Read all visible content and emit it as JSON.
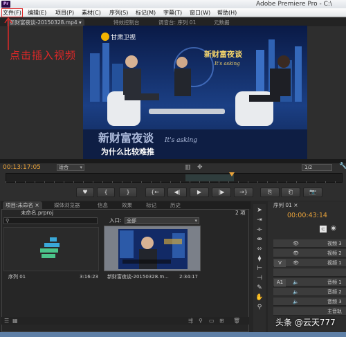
{
  "window": {
    "app_icon_text": "Pr",
    "title": "Adobe Premiere Pro - C:\\"
  },
  "menu": [
    {
      "label": "文件(F)"
    },
    {
      "label": "编辑(E)"
    },
    {
      "label": "项目(P)"
    },
    {
      "label": "素材(C)"
    },
    {
      "label": "序列(S)"
    },
    {
      "label": "标记(M)"
    },
    {
      "label": "字幕(T)"
    },
    {
      "label": "窗口(W)"
    },
    {
      "label": "帮助(H)"
    }
  ],
  "annotation": {
    "text": "点击插入视频",
    "color": "#e02828"
  },
  "source_tabs": [
    {
      "label": "新财富夜谈-20150328.mp4 ▾"
    },
    {
      "label": "特效控制台"
    },
    {
      "label": "调音台: 序列 01"
    },
    {
      "label": "元数据"
    }
  ],
  "video": {
    "channel_logo": "甘肃卫视",
    "show_logo_line1": "新财富夜谈",
    "show_logo_line2": "It's asking",
    "subtitle": "为什么比较难推"
  },
  "source_controls": {
    "timecode": "00:13:17:05",
    "fit": "适合",
    "resolution": "1/2"
  },
  "transport_buttons": [
    "♥",
    "{",
    "}",
    "{←",
    "◀|",
    "▶",
    "|▶",
    "→}",
    "⎘",
    "⎗",
    "📷"
  ],
  "project": {
    "tabs": [
      "项目:未命名 ×",
      "媒体浏览器",
      "信息",
      "效果",
      "标记",
      "历史"
    ],
    "file": "未命名.prproj",
    "count": "2 项",
    "search_placeholder": "",
    "in_label": "入口:",
    "in_value": "全部",
    "items": [
      {
        "name": "序列 01",
        "duration": "3:16:23"
      },
      {
        "name": "新财富夜谈-20150328.m...",
        "duration": "2:34:17"
      }
    ]
  },
  "timeline": {
    "tab": "序列 01 ×",
    "timecode": "00:00:43:14",
    "tracks": [
      {
        "side": "",
        "label": "视频 3"
      },
      {
        "side": "",
        "label": "视频 2"
      },
      {
        "side": "V",
        "label": "视频 1"
      },
      {
        "side": "",
        "label": ""
      },
      {
        "side": "A1",
        "label": "音频 1"
      },
      {
        "side": "",
        "label": "音频 2"
      },
      {
        "side": "",
        "label": "音频 3"
      },
      {
        "side": "",
        "label": "主音轨"
      }
    ]
  },
  "watermark": "头条 @云天777",
  "colors": {
    "timecode": "#e8a23a",
    "accent_red": "#e02828",
    "panel": "#2e2e2e"
  }
}
